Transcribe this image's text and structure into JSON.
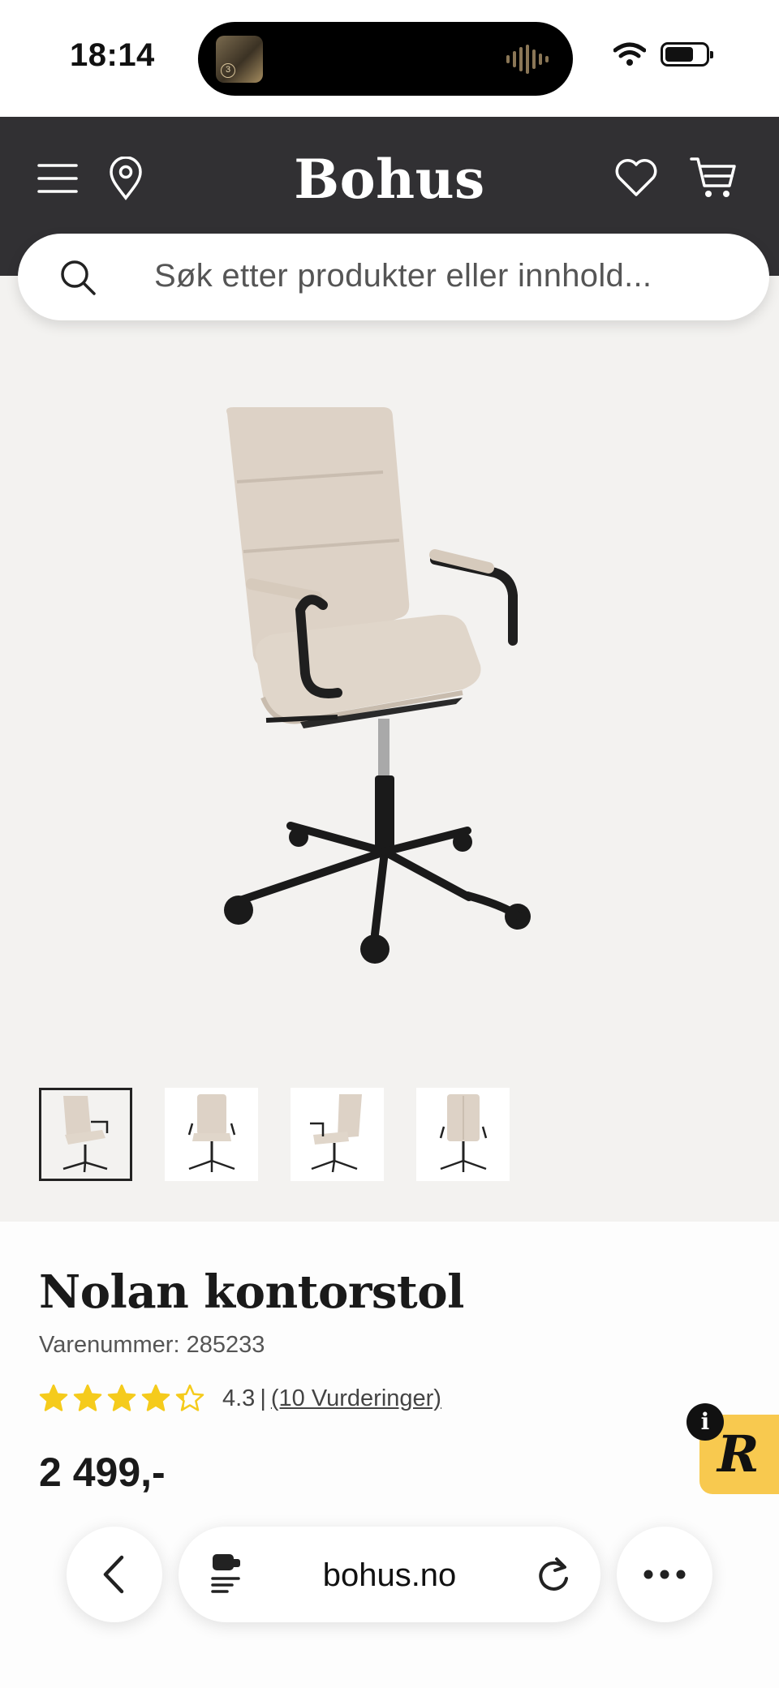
{
  "status_bar": {
    "time": "18:14"
  },
  "header": {
    "brand": "Bohus",
    "icons": [
      "menu-icon",
      "location-pin-icon",
      "heart-icon",
      "cart-icon"
    ]
  },
  "search": {
    "placeholder": "Søk etter produkter eller innhold..."
  },
  "gallery": {
    "thumbnail_count": 4,
    "selected_index": 0
  },
  "product": {
    "title": "Nolan kontorstol",
    "sku": "Varenummer: 285233",
    "rating_value": "4.3",
    "rating_separator": "|",
    "rating_link": "(10 Vurderinger)",
    "rating": 4.3,
    "rating_max": 5,
    "price": "2 499,-"
  },
  "review_badge": {
    "letter": "R",
    "info": "i"
  },
  "browser": {
    "url": "bohus.no"
  },
  "colors": {
    "header_bg": "#313033",
    "gallery_bg": "#f3f2f0",
    "star": "#f5cb1c",
    "badge": "#f8c94f"
  }
}
